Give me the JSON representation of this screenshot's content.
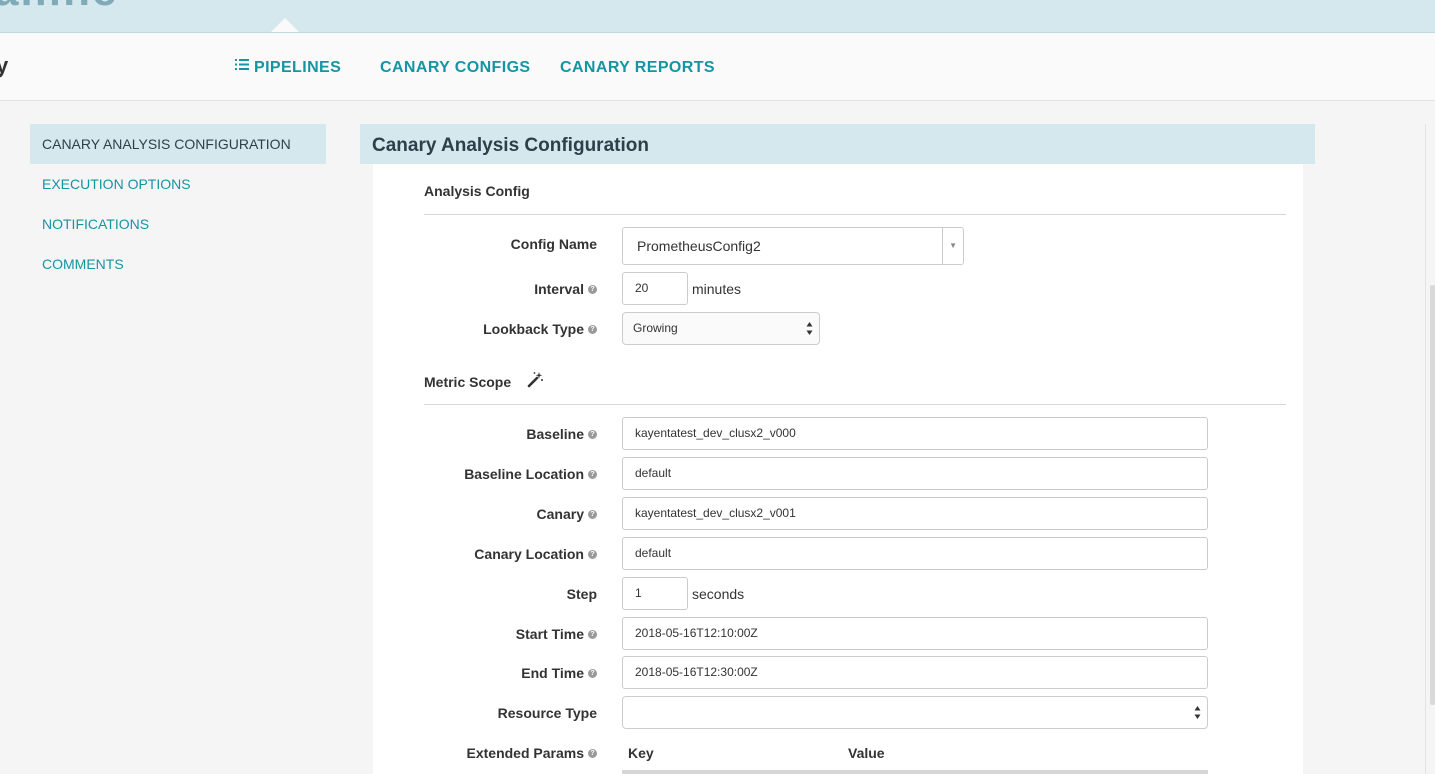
{
  "banner": {
    "title_fragment": "ailine"
  },
  "nav": {
    "left_fragment": "y",
    "links": [
      {
        "label": "PIPELINES",
        "icon": "list-icon"
      },
      {
        "label": "CANARY CONFIGS"
      },
      {
        "label": "CANARY REPORTS"
      }
    ]
  },
  "sidebar": {
    "items": [
      {
        "label": "CANARY ANALYSIS CONFIGURATION",
        "active": true
      },
      {
        "label": "EXECUTION OPTIONS"
      },
      {
        "label": "NOTIFICATIONS"
      },
      {
        "label": "COMMENTS"
      }
    ]
  },
  "panel": {
    "title": "Canary Analysis Configuration",
    "analysis_config": {
      "heading": "Analysis Config",
      "config_name": {
        "label": "Config Name",
        "value": "PrometheusConfig2"
      },
      "interval": {
        "label": "Interval",
        "value": "20",
        "unit": "minutes"
      },
      "lookback_type": {
        "label": "Lookback Type",
        "value": "Growing"
      }
    },
    "metric_scope": {
      "heading": "Metric Scope",
      "icon": "magic-wand-icon",
      "baseline": {
        "label": "Baseline",
        "value": "kayentatest_dev_clusx2_v000"
      },
      "baseline_location": {
        "label": "Baseline Location",
        "value": "default"
      },
      "canary": {
        "label": "Canary",
        "value": "kayentatest_dev_clusx2_v001"
      },
      "canary_location": {
        "label": "Canary Location",
        "value": "default"
      },
      "step": {
        "label": "Step",
        "value": "1",
        "unit": "seconds"
      },
      "start_time": {
        "label": "Start Time",
        "value": "2018-05-16T12:10:00Z"
      },
      "end_time": {
        "label": "End Time",
        "value": "2018-05-16T12:30:00Z"
      },
      "resource_type": {
        "label": "Resource Type",
        "value": ""
      },
      "extended_params": {
        "label": "Extended Params",
        "key_header": "Key",
        "value_header": "Value"
      }
    }
  },
  "colors": {
    "accent": "#1595a3",
    "header_bg": "#d4e8ee"
  }
}
